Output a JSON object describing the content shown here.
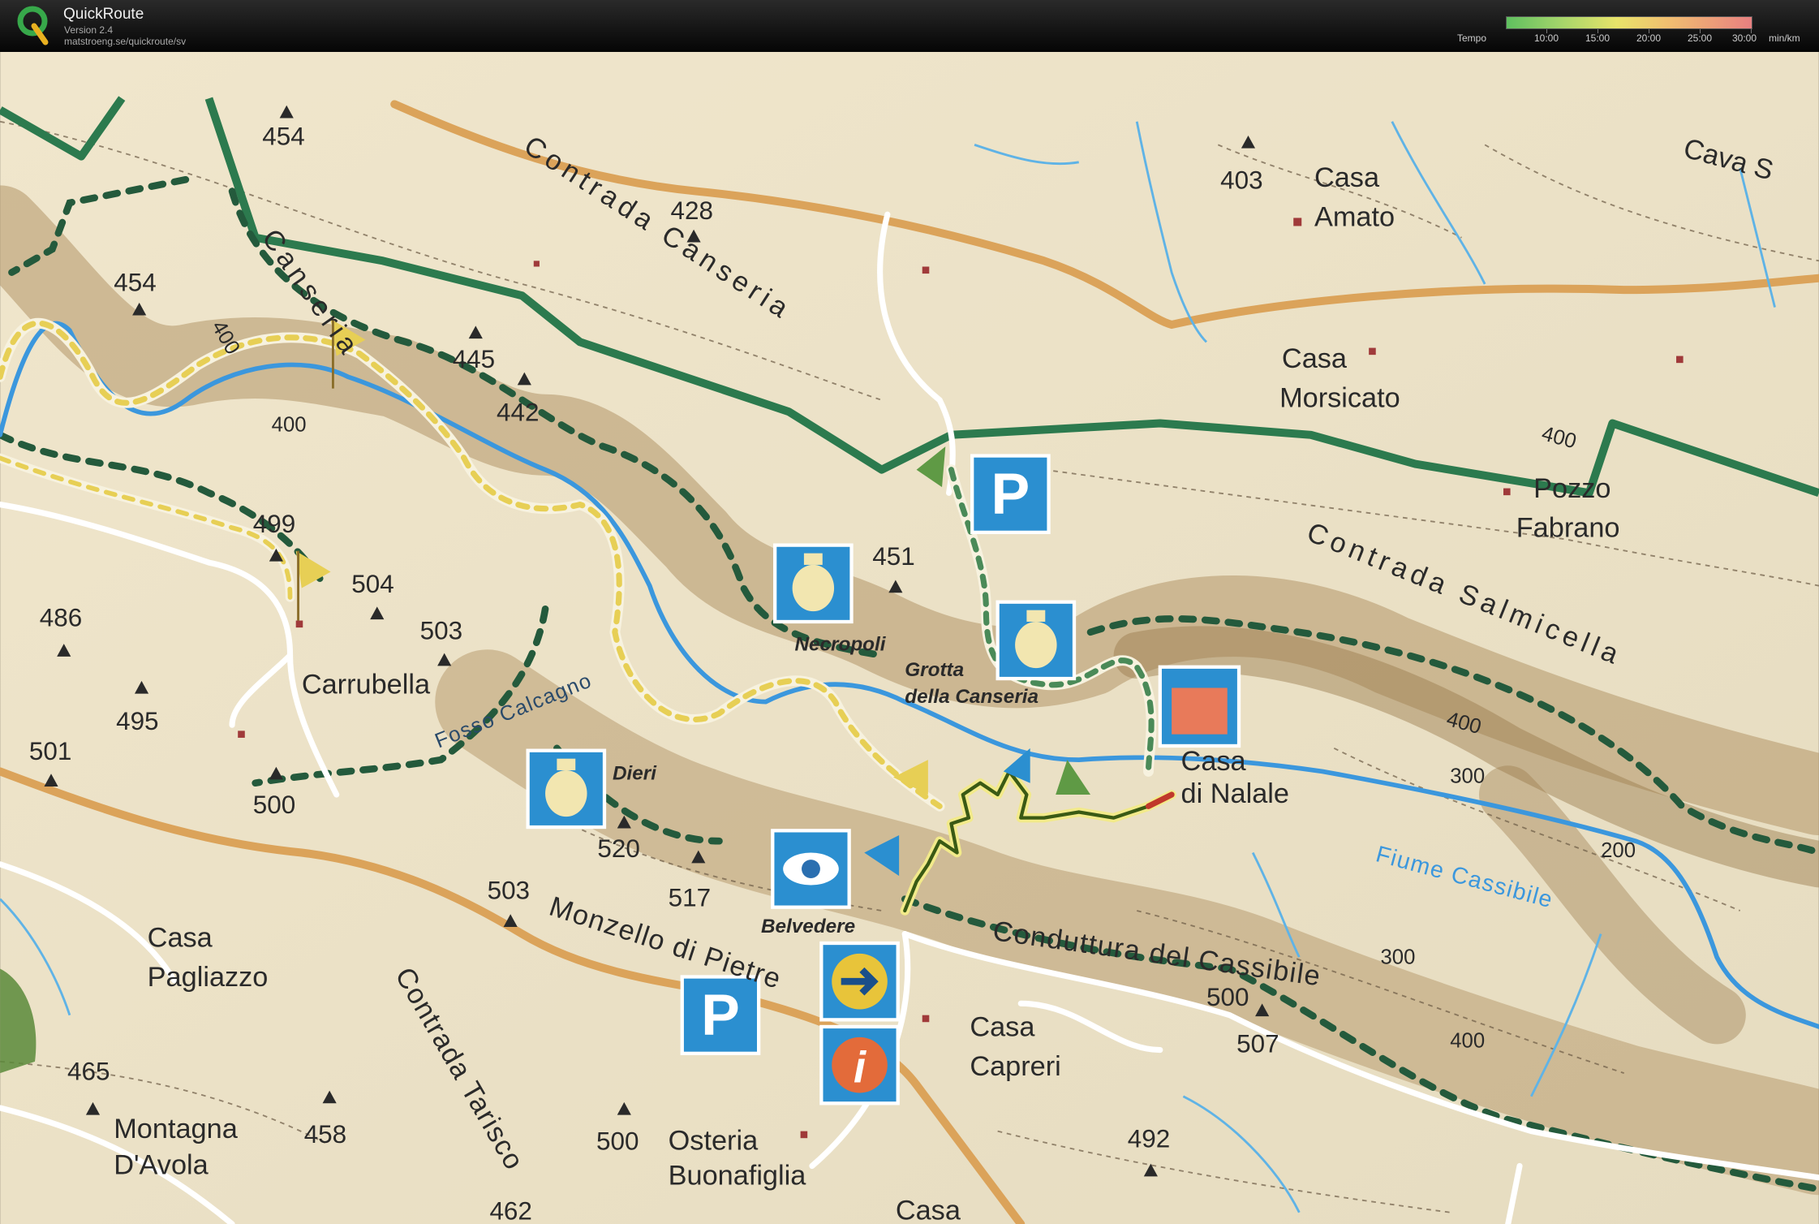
{
  "header": {
    "app_name": "QuickRoute",
    "version": "Version 2.4",
    "url": "matstroeng.se/quickroute/sv",
    "tempo_label": "Tempo",
    "tempo_ticks": [
      "10:00",
      "15:00",
      "20:00",
      "25:00",
      "30:00"
    ],
    "tempo_unit": "min/km"
  },
  "map": {
    "places": {
      "casa_amato_1": "Casa",
      "casa_amato_2": "Amato",
      "casa_morsicato_1": "Casa",
      "casa_morsicato_2": "Morsicato",
      "pozzo_fabrano_1": "Pozzo",
      "pozzo_fabrano_2": "Fabrano",
      "carrubella": "Carrubella",
      "casa_pagliazzo_1": "Casa",
      "casa_pagliazzo_2": "Pagliazzo",
      "montagna_1": "Montagna",
      "montagna_2": "D'Avola",
      "casa_natale_1": "Casa",
      "casa_natale_2": "di Nalale",
      "casa_capreri_1": "Casa",
      "casa_capreri_2": "Capreri",
      "osteria_1": "Osteria",
      "osteria_2": "Buonafiglia",
      "casa_bottom": "Casa",
      "cava": "Cava S"
    },
    "roads": {
      "contrada_canseria": "Contrada Canseria",
      "canseria_top": "Canseria",
      "contrada_salmicella": "Contrada Salmicella",
      "monzello": "Monzello di Pietre",
      "contrada_tarisco": "Contrada Tarisco",
      "fosso_calcagno": "Fosso Calcagno",
      "conduttura": "Conduttura del Cassibile",
      "fiume": "Fiume Cassibile"
    },
    "pois": {
      "necropoli": "Necropoli",
      "grotta_1": "Grotta",
      "grotta_2": "della Canseria",
      "dieri": "Dieri",
      "belvedere": "Belvedere"
    },
    "elevations": [
      {
        "v": "454"
      },
      {
        "v": "454"
      },
      {
        "v": "428"
      },
      {
        "v": "445"
      },
      {
        "v": "442"
      },
      {
        "v": "499"
      },
      {
        "v": "504"
      },
      {
        "v": "503"
      },
      {
        "v": "486"
      },
      {
        "v": "495"
      },
      {
        "v": "501"
      },
      {
        "v": "500"
      },
      {
        "v": "451"
      },
      {
        "v": "520"
      },
      {
        "v": "517"
      },
      {
        "v": "503"
      },
      {
        "v": "403"
      },
      {
        "v": "465"
      },
      {
        "v": "458"
      },
      {
        "v": "500"
      },
      {
        "v": "492"
      },
      {
        "v": "500"
      },
      {
        "v": "507"
      },
      {
        "v": "462"
      }
    ],
    "contours": [
      {
        "v": "400"
      },
      {
        "v": "400"
      },
      {
        "v": "400"
      },
      {
        "v": "400"
      },
      {
        "v": "300"
      },
      {
        "v": "200"
      },
      {
        "v": "300"
      },
      {
        "v": "400"
      }
    ],
    "icons": {
      "parking": "P",
      "info": "i"
    }
  },
  "colors": {
    "map_bg": "#ece2c6",
    "ridge": "#a98a5e",
    "green_boundary": "#2c7a4e",
    "orange_road": "#dba35a",
    "river": "#3b97dd",
    "icon_blue": "#2b8fd0",
    "route": "#3a5a14"
  }
}
